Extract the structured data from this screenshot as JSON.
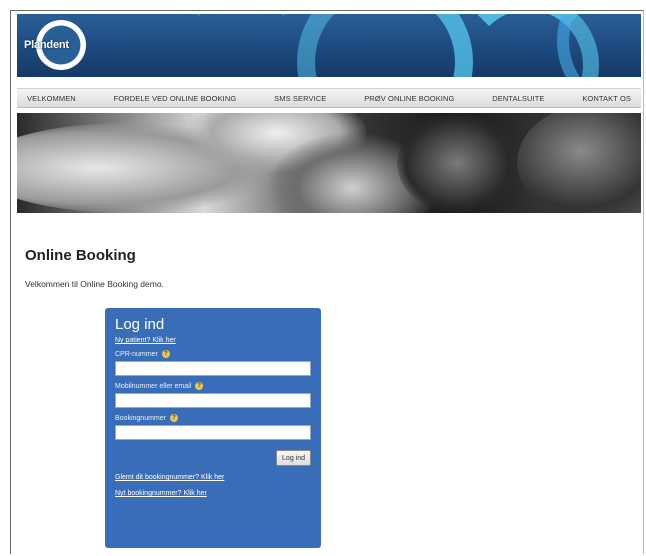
{
  "brand": {
    "logo_text": "Plandent"
  },
  "nav": {
    "items": [
      {
        "label": "VELKOMMEN"
      },
      {
        "label": "FORDELE VED ONLINE BOOKING"
      },
      {
        "label": "SMS SERVICE"
      },
      {
        "label": "PRØV ONLINE BOOKING"
      },
      {
        "label": "DENTALSUITE"
      },
      {
        "label": "KONTAKT OS"
      }
    ]
  },
  "page": {
    "title": "Online Booking",
    "welcome": "Velkommen til Online Booking demo."
  },
  "login": {
    "title": "Log ind",
    "new_patient_link": "Ny patient? Klik her",
    "cpr_label": "CPR-nummer",
    "cpr_value": "",
    "phone_label": "Mobilnummer eller email",
    "phone_value": "",
    "booking_label": "Bookingnummer",
    "booking_value": "",
    "submit_label": "Log ind",
    "forgot_link": "Glemt dit bookingnummer? Klik her",
    "new_booking_link": "Nyt bookingnummer? Klik her",
    "help_glyph": "?"
  },
  "colors": {
    "banner": "#1d4a7f",
    "login_panel": "#3a6db7",
    "help_icon": "#e6c55a"
  }
}
